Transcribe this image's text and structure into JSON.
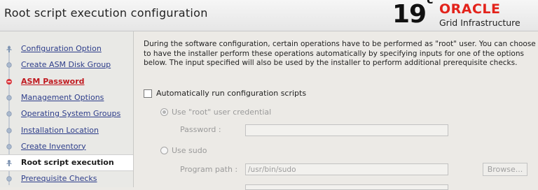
{
  "header": {
    "title": "Root script execution configuration",
    "brand_version": "19",
    "brand_sup": "c",
    "brand_name": "ORACLE",
    "brand_product": "Grid Infrastructure"
  },
  "sidebar": {
    "items": [
      {
        "label": "Configuration Option",
        "state": "link"
      },
      {
        "label": "Create ASM Disk Group",
        "state": "link"
      },
      {
        "label": "ASM Password",
        "state": "error"
      },
      {
        "label": "Management Options",
        "state": "link"
      },
      {
        "label": "Operating System Groups",
        "state": "link"
      },
      {
        "label": "Installation Location",
        "state": "link"
      },
      {
        "label": "Create Inventory",
        "state": "link"
      },
      {
        "label": "Root script execution",
        "state": "current"
      },
      {
        "label": "Prerequisite Checks",
        "state": "link"
      }
    ]
  },
  "main": {
    "description": "During the software configuration, certain operations have to be performed as \"root\" user. You can choose to have the installer perform these operations automatically by specifying inputs for one of the options below. The input specified will also be used by the installer to perform additional prerequisite checks.",
    "auto_run_label": "Automatically run configuration scripts",
    "auto_run_checked": false,
    "root_option_label": "Use \"root\" user credential",
    "root_option_selected": true,
    "password_label": "Password :",
    "password_value": "",
    "sudo_option_label": "Use sudo",
    "sudo_option_selected": false,
    "program_path_label": "Program path :",
    "program_path_value": "/usr/bin/sudo",
    "browse_label": "Browse..."
  },
  "colors": {
    "oracle_red": "#e3231b",
    "link": "#2d3d8a",
    "error": "#c0191f"
  }
}
